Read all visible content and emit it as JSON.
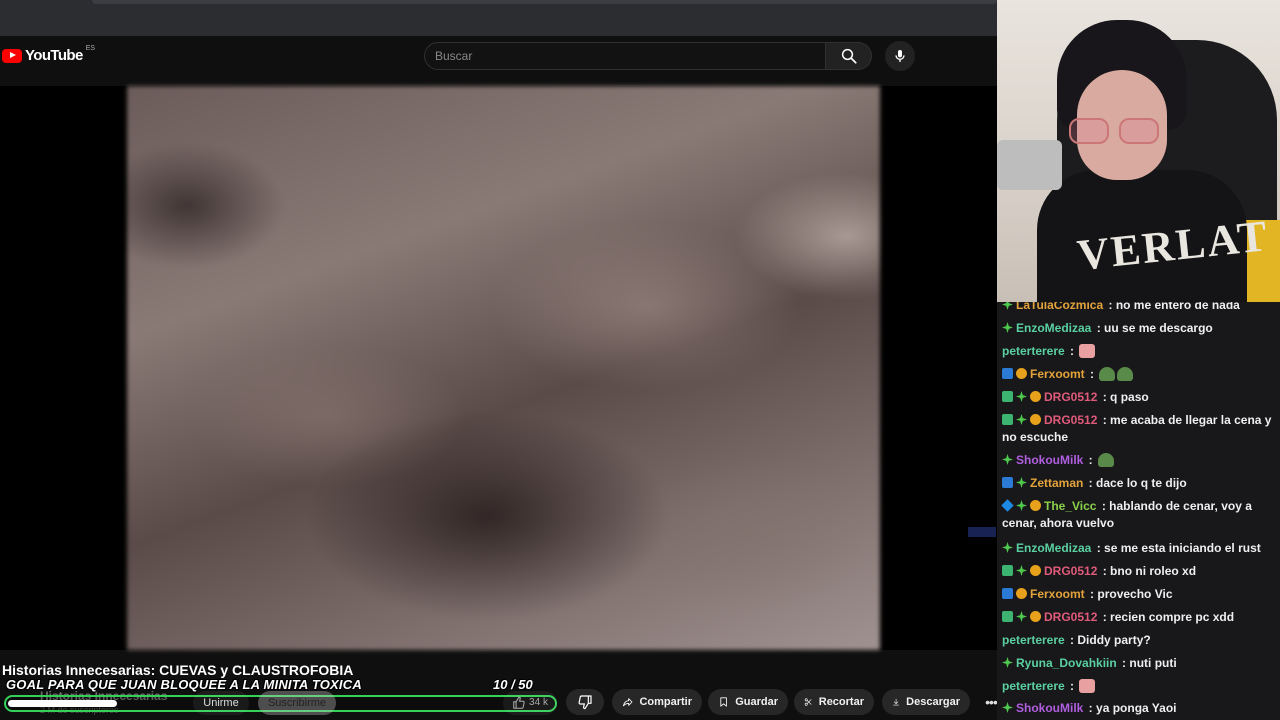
{
  "youtube": {
    "logo_text": "YouTube",
    "logo_country": "ES",
    "search_placeholder": "Buscar",
    "video_title": "Historias Innecesarias: CUEVAS y CLAUSTROFOBIA",
    "channel_name": "Historias Innecesarias",
    "subscriber_count": "2 M de suscriptores",
    "join_label": "Unirme",
    "subscribe_label": "Suscribirme",
    "like_count": "34 k",
    "share_label": "Compartir",
    "save_label": "Guardar",
    "clip_label": "Recortar",
    "download_label": "Descargar",
    "more_label": "•••"
  },
  "overlay": {
    "goal_text": "GOAL PARA QUE JUAN BLOQUEE A LA MINITA TOXICA",
    "goal_count": "10  / 50",
    "goal_progress": 0.2,
    "goal_color": "#34d058"
  },
  "chat": {
    "messages": [
      {
        "badges": [
          "green"
        ],
        "user": "LaTulaCozmica",
        "color": "#e4a33a",
        "text": "no me entero de nada"
      },
      {
        "badges": [
          "green"
        ],
        "user": "EnzoMedizaa",
        "color": "#5ad0a0",
        "text": "uu se me descargo"
      },
      {
        "badges": [],
        "user": "peterterere",
        "color": "#5ad0a0",
        "text": "",
        "emotes": [
          "pink"
        ]
      },
      {
        "badges": [
          "blue",
          "gold"
        ],
        "user": "Ferxoomt",
        "color": "#e4a33a",
        "text": "",
        "emotes": [
          "frog",
          "frog"
        ]
      },
      {
        "badges": [
          "cube",
          "green",
          "gold"
        ],
        "user": "DRG0512",
        "color": "#e05a7a",
        "text": "q paso"
      },
      {
        "badges": [
          "cube",
          "green",
          "gold"
        ],
        "user": "DRG0512",
        "color": "#e05a7a",
        "text": "me acaba de llegar la cena y no escuche"
      },
      {
        "badges": [
          "green"
        ],
        "user": "ShokouMilk",
        "color": "#b05ee0",
        "text": "",
        "emotes": [
          "frog"
        ]
      },
      {
        "badges": [
          "blue",
          "green"
        ],
        "user": "Zettaman",
        "color": "#e4a33a",
        "text": "dace lo q te dijo"
      },
      {
        "badges": [
          "dia",
          "green",
          "gold"
        ],
        "user": "The_Vicc",
        "color": "#8ad04a",
        "text": "hablando de cenar, voy a cenar, ahora vuelvo"
      },
      {
        "badges": [
          "green"
        ],
        "user": "EnzoMedizaa",
        "color": "#5ad0a0",
        "text": "se me esta iniciando el rust"
      },
      {
        "badges": [
          "cube",
          "green",
          "gold"
        ],
        "user": "DRG0512",
        "color": "#e05a7a",
        "text": "bno ni roleo xd"
      },
      {
        "badges": [
          "blue",
          "gold"
        ],
        "user": "Ferxoomt",
        "color": "#e4a33a",
        "text": "provecho Vic"
      },
      {
        "badges": [
          "cube",
          "green",
          "gold"
        ],
        "user": "DRG0512",
        "color": "#e05a7a",
        "text": "recien compre pc xdd"
      },
      {
        "badges": [],
        "user": "peterterere",
        "color": "#5ad0a0",
        "text": "Diddy party?"
      },
      {
        "badges": [
          "green"
        ],
        "user": "Ryuna_Dovahkiin",
        "color": "#5ad0a0",
        "text": "nuti puti"
      },
      {
        "badges": [],
        "user": "peterterere",
        "color": "#5ad0a0",
        "text": "",
        "emotes": [
          "pink"
        ]
      },
      {
        "badges": [
          "green"
        ],
        "user": "ShokouMilk",
        "color": "#b05ee0",
        "text": "ya ponga Yaoi"
      }
    ]
  },
  "webcam": {
    "shirt_print": "VERLAT"
  }
}
